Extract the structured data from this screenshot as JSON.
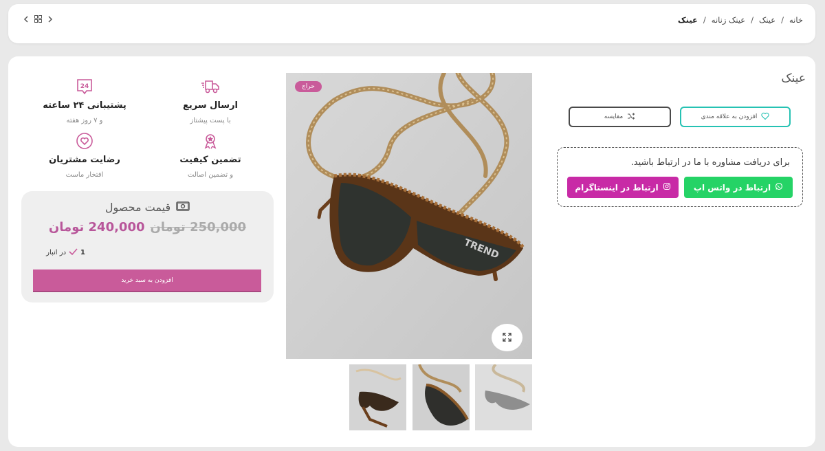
{
  "breadcrumb": {
    "items": [
      "خانه",
      "عینک",
      "عینک زنانه",
      "عینک"
    ],
    "separator": "/"
  },
  "nav": {
    "grid_icon": "grid-icon",
    "prev_icon": "chevron-left-icon",
    "next_icon": "chevron-right-icon"
  },
  "product": {
    "title": "عینک",
    "badge": "حراج",
    "wishlist_label": "افزودن به علاقه مندی",
    "compare_label": "مقایسه"
  },
  "consult": {
    "text": "برای دریافت مشاوره با ما در ارتباط باشید.",
    "whatsapp_label": "ارتباط در واتس اپ",
    "instagram_label": "ارتباط در اینستاگرام"
  },
  "features": [
    {
      "title": "پشتیبانی ۲۴ ساعته",
      "subtitle": "و ۷ روز هفته",
      "icon": "support-24-icon",
      "icon_text": "24"
    },
    {
      "title": "ارسال سریع",
      "subtitle": "با پست پیشتاز",
      "icon": "truck-icon"
    },
    {
      "title": "رضایت مشتریان",
      "subtitle": "افتخار ماست",
      "icon": "heart-icon"
    },
    {
      "title": "تضمین کیفیت",
      "subtitle": "و تضمین اصالت",
      "icon": "award-icon"
    }
  ],
  "price": {
    "heading": "قیمت محصول",
    "old": "250,000",
    "old_unit": "تومان",
    "new": "240,000",
    "new_unit": "تومان",
    "stock_qty": "1",
    "stock_label": "در انبار",
    "cart_label": "افزودن به سبد خرید"
  },
  "colors": {
    "accent_pink": "#c95b9a",
    "teal": "#26c2b3",
    "whatsapp": "#25d366",
    "instagram": "#c82aa6"
  }
}
